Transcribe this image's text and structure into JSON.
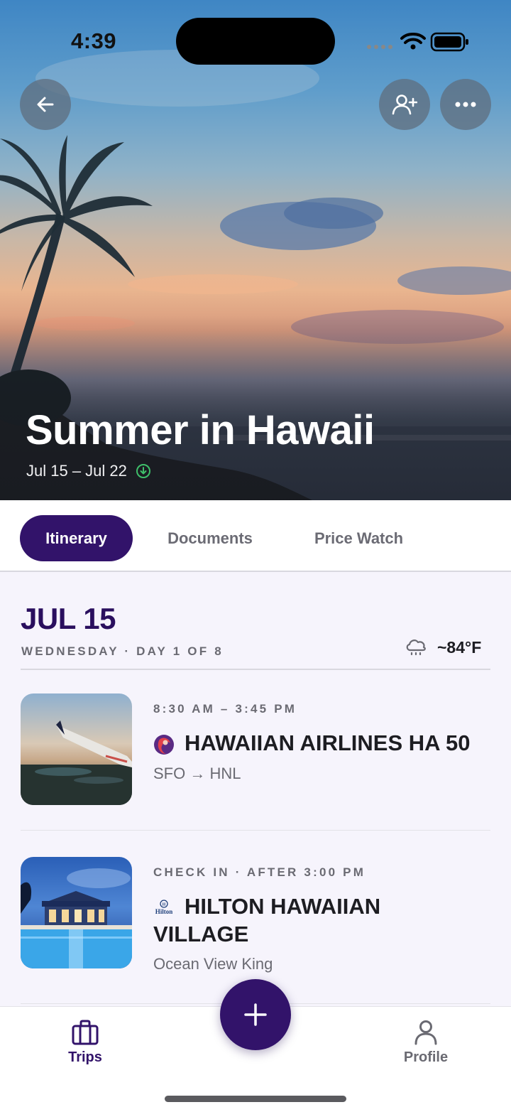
{
  "status_bar": {
    "time": "4:39"
  },
  "hero": {
    "title": "Summer in Hawaii",
    "dates": "Jul 15 – Jul 22",
    "buttons": {
      "back": "arrow-left-icon",
      "invite": "user-plus-icon",
      "more": "more-horizontal-icon"
    }
  },
  "tabs": [
    {
      "label": "Itinerary",
      "active": true
    },
    {
      "label": "Documents",
      "active": false
    },
    {
      "label": "Price Watch",
      "active": false
    }
  ],
  "day": {
    "date": "JUL 15",
    "subtitle": "WEDNESDAY · DAY 1 OF 8",
    "weather_icon": "cloud-drizzle-icon",
    "temperature": "~84°F"
  },
  "items": [
    {
      "meta": "8:30 AM – 3:45 PM",
      "title": "HAWAIIAN AIRLINES HA 50",
      "subtitle": "SFO → HNL",
      "logo": "hawaiian-airlines-logo",
      "image": "airplane-wing-photo"
    },
    {
      "meta": "CHECK IN · AFTER 3:00 PM",
      "title_line1": "HILTON HAWAIIAN",
      "title_line2": "VILLAGE",
      "subtitle": "Ocean View King",
      "logo": "hilton-logo",
      "logo_text": "Hilton",
      "image": "hotel-pool-photo"
    }
  ],
  "bottom_nav": {
    "trips_label": "Trips",
    "profile_label": "Profile",
    "active": "Trips"
  },
  "colors": {
    "brand": "#32136a",
    "day_heading": "#2a0f5e",
    "muted": "#6a6a72",
    "page_bg": "#f6f4fc"
  }
}
